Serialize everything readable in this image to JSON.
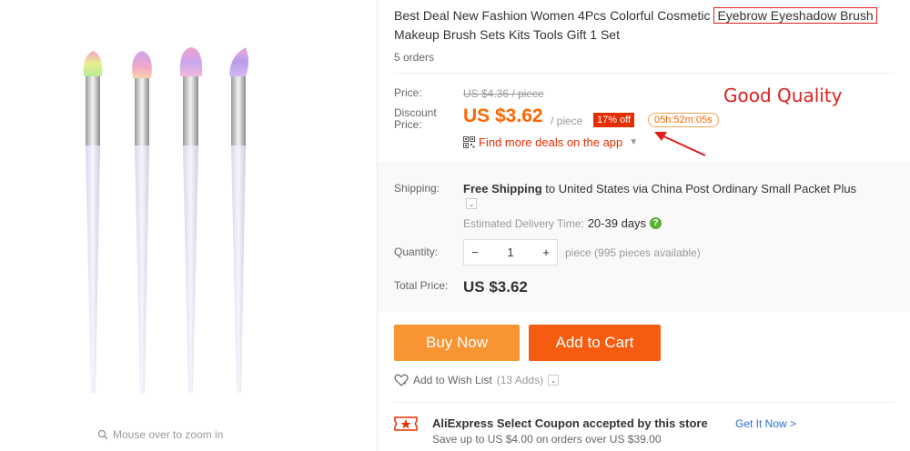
{
  "gallery": {
    "zoom_hint": "Mouse over to zoom in"
  },
  "product": {
    "title_part1": "Best Deal New Fashion Women 4Pcs Colorful Cosmetic ",
    "title_highlight": "Eyebrow Eyeshadow Brush",
    "title_part2": "Makeup Brush Sets Kits Tools Gift 1 Set",
    "orders": "5 orders"
  },
  "pricing": {
    "price_label": "Price:",
    "original_price": "US $4.36 / piece",
    "discount_label_line1": "Discount",
    "discount_label_line2": "Price:",
    "current_price": "US $3.62",
    "per_piece": "/ piece",
    "off_badge": "17% off",
    "countdown": "05h:52m:05s",
    "app_deals": "Find more deals on the app",
    "annotation": "Good Quality"
  },
  "shipping": {
    "label": "Shipping:",
    "free_shipping": "Free Shipping",
    "to": " to ",
    "destination": "United States via China Post Ordinary Small Packet Plus",
    "estimated_label": "Estimated Delivery Time:",
    "estimated_days": "20-39 days"
  },
  "quantity": {
    "label": "Quantity:",
    "value": "1",
    "available": "piece (995 pieces available)"
  },
  "total": {
    "label": "Total Price:",
    "value": "US $3.62"
  },
  "actions": {
    "buy_now": "Buy Now",
    "add_to_cart": "Add to Cart",
    "wish_list": "Add to Wish List",
    "wish_count": "(13 Adds)"
  },
  "coupon": {
    "title": "AliExpress Select Coupon accepted by this store",
    "link": "Get It Now >",
    "subtitle": "Save up to US $4.00 on orders over US $39.00"
  },
  "colors": {
    "accent_orange": "#f60",
    "buy_button": "#f89431",
    "cart_button": "#f55c0f",
    "discount_red": "#e62e04"
  },
  "icons": [
    "search-icon",
    "qr-code-icon",
    "chevron-down-icon",
    "help-icon",
    "minus-icon",
    "plus-icon",
    "heart-icon",
    "coupon-icon"
  ]
}
